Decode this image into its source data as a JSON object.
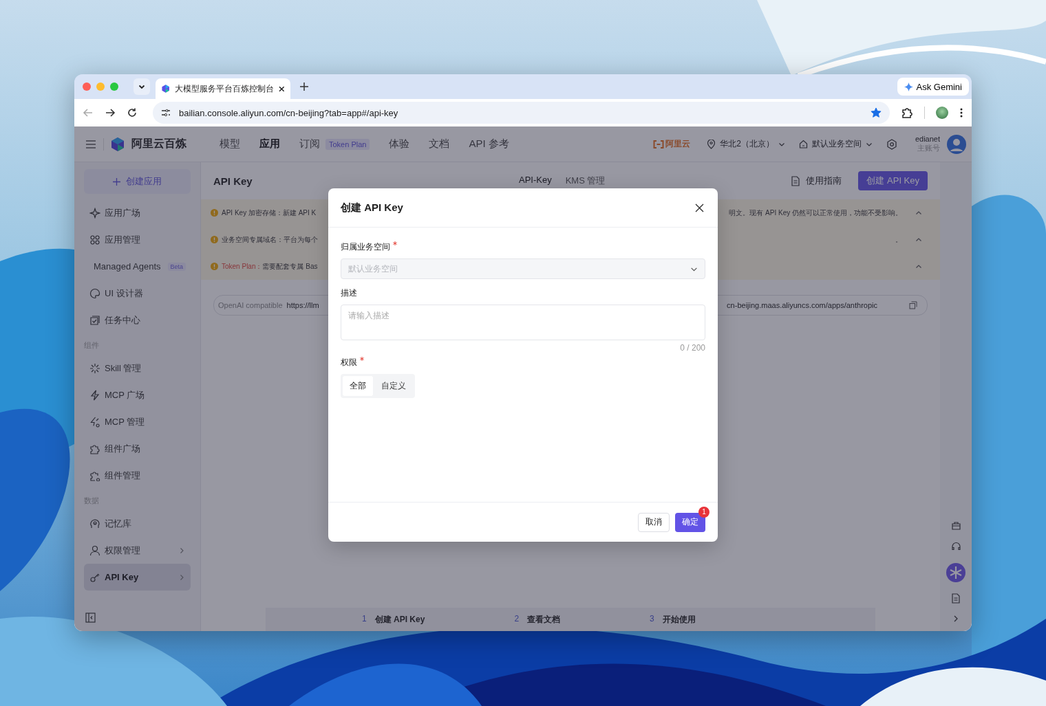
{
  "browser": {
    "tabs": [
      {
        "title": "大模型服务平台百炼控制台",
        "selected": true
      }
    ],
    "ask_button": "Ask Gemini",
    "url": "bailian.console.aliyun.com/cn-beijing?tab=app#/api-key",
    "bookmarked": true
  },
  "topbar": {
    "brand": "阿里云百炼",
    "nav": [
      {
        "label": "模型",
        "selected": false
      },
      {
        "label": "应用",
        "selected": true
      },
      {
        "label": "订阅",
        "selected": false,
        "badge": "Token Plan"
      },
      {
        "label": "体验",
        "selected": false
      },
      {
        "label": "文档",
        "selected": false
      },
      {
        "label": "API 参考",
        "selected": false
      }
    ],
    "partner_logo": "阿里云",
    "region": "华北2（北京）",
    "workspace": "默认业务空间",
    "user": {
      "name": "edianet",
      "role": "主账号"
    }
  },
  "sidebar": {
    "create_button": "创建应用",
    "sections": [
      {
        "items": [
          {
            "label": "应用广场",
            "selected": false
          },
          {
            "label": "应用管理",
            "selected": false
          },
          {
            "label": "Managed Agents",
            "selected": false,
            "badge": "Beta"
          },
          {
            "label": "UI 设计器",
            "selected": false
          },
          {
            "label": "任务中心",
            "selected": false
          }
        ]
      },
      {
        "title": "组件",
        "items": [
          {
            "label": "Skill 管理",
            "selected": false
          },
          {
            "label": "MCP 广场",
            "selected": false
          },
          {
            "label": "MCP 管理",
            "selected": false
          },
          {
            "label": "组件广场",
            "selected": false
          },
          {
            "label": "组件管理",
            "selected": false
          }
        ]
      },
      {
        "title": "数据",
        "items": [
          {
            "label": "记忆库",
            "selected": false
          },
          {
            "label": "权限管理",
            "selected": false,
            "expanded": false
          },
          {
            "label": "API Key",
            "selected": true,
            "expanded": false
          }
        ]
      }
    ]
  },
  "main": {
    "title": "API Key",
    "tabs": [
      {
        "label": "API-Key",
        "selected": true
      },
      {
        "label": "KMS 管理",
        "selected": false
      }
    ],
    "guide_link": "使用指南",
    "create_button": "创建 API Key",
    "alerts": [
      {
        "kind": "plain",
        "label": "API Key 加密存储：",
        "text": "新建 API K",
        "tail": "明文。现有 API Key 仍然可以正常使用，功能不受影响。",
        "expanded": true
      },
      {
        "kind": "plain",
        "label": "业务空间专属域名：",
        "text": "平台为每个",
        "tail": "。",
        "expanded": true
      },
      {
        "kind": "highlight",
        "label": "Token Plan：",
        "text": "需要配套专属 Bas",
        "expanded": true
      }
    ],
    "endpoint": {
      "label": "OpenAI compatible",
      "value_start": "https://llm",
      "value_end": "cn-beijing.maas.aliyuncs.com/apps/anthropic"
    },
    "steps": [
      {
        "number": "1",
        "label": "创建 API Key"
      },
      {
        "number": "2",
        "label": "查看文档"
      },
      {
        "number": "3",
        "label": "开始使用"
      }
    ]
  },
  "modal": {
    "title": "创建 API Key",
    "fields": [
      {
        "kind": "select",
        "label": "归属业务空间",
        "required": true,
        "value": "默认业务空间",
        "disabled": true
      },
      {
        "kind": "textarea",
        "label": "描述",
        "required": false,
        "placeholder": "请输入描述",
        "counter": "0 / 200"
      },
      {
        "kind": "segmented",
        "label": "权限",
        "required": true,
        "options": [
          {
            "label": "全部",
            "selected": true
          },
          {
            "label": "自定义",
            "selected": false
          }
        ]
      }
    ],
    "buttons": [
      {
        "kind": "secondary",
        "label": "取消"
      },
      {
        "kind": "primary",
        "label": "确定",
        "badge": "1"
      }
    ]
  }
}
